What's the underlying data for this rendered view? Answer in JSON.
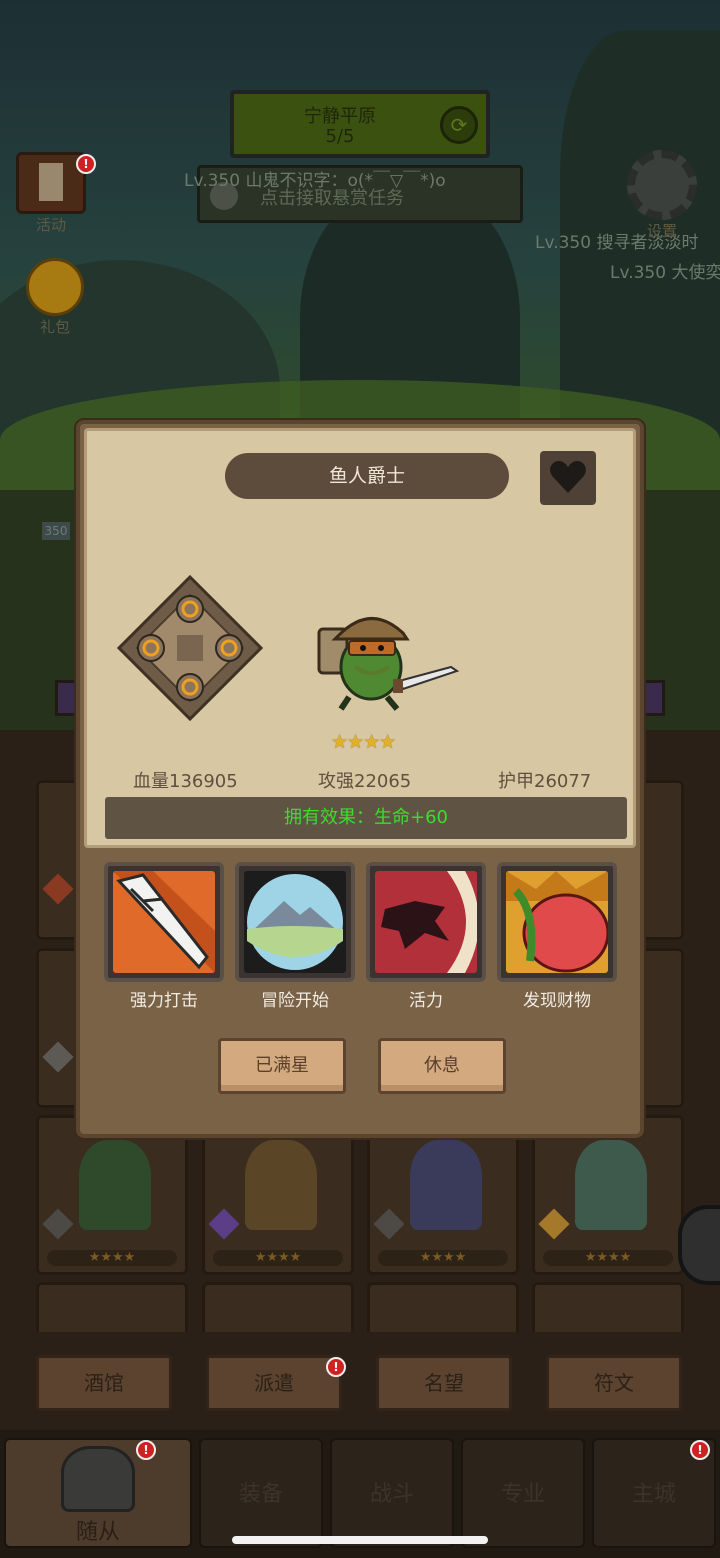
{
  "map": {
    "title": "宁静平原",
    "progress": "5/5"
  },
  "bounty": {
    "text": "点击接取悬赏任务"
  },
  "chat": [
    "Lv.350 山鬼不识字：o(*￣▽￣*)o",
    "Lv.350 搜寻者淡淡时",
    "Lv.350 大使奕"
  ],
  "side_buttons": {
    "activity": "活动",
    "gift": "礼包",
    "settings": "设置"
  },
  "bg_level": "350",
  "hero": {
    "name": "鱼人爵士",
    "stars": "★★★★",
    "hp": "血量136905",
    "attack": "攻强22065",
    "armor": "护甲26077",
    "effect": "拥有效果：生命+60"
  },
  "skills": [
    {
      "label": "强力打击",
      "icon": "sword-strike-icon"
    },
    {
      "label": "冒险开始",
      "icon": "mountain-icon"
    },
    {
      "label": "活力",
      "icon": "shadow-fighter-icon"
    },
    {
      "label": "发现财物",
      "icon": "treasure-bag-icon"
    }
  ],
  "actions": {
    "max_star": "已满星",
    "rest": "休息"
  },
  "slot_stars": "★★★★",
  "nav": [
    "酒馆",
    "派遣",
    "名望",
    "符文"
  ],
  "tabs": [
    "随从",
    "装备",
    "战斗",
    "专业",
    "主城"
  ],
  "badge": "!",
  "colors": {
    "effect_text": "#3ddc2c",
    "star": "#e2b12a",
    "parchment": "#d8c7a3"
  }
}
